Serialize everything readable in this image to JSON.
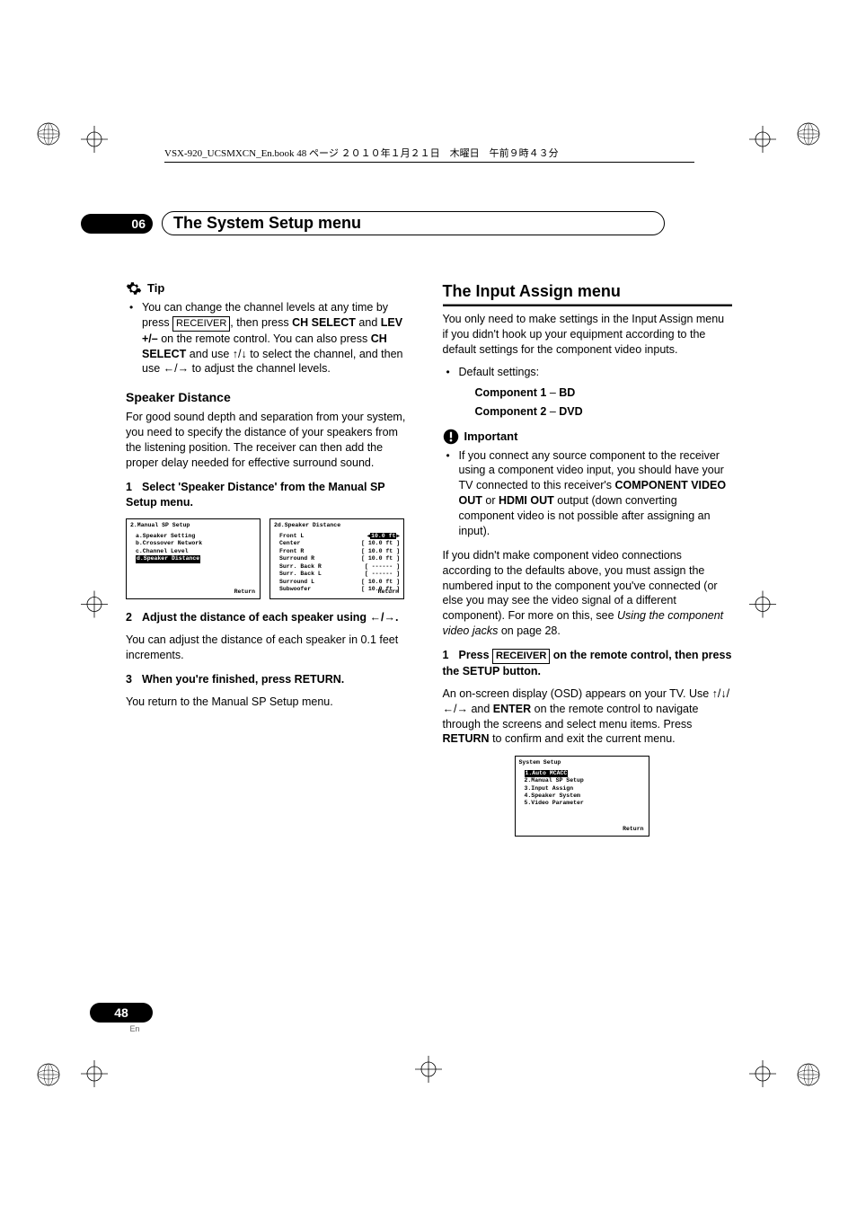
{
  "header_line": "VSX-920_UCSMXCN_En.book  48 ページ  ２０１０年１月２１日　木曜日　午前９時４３分",
  "chapter": {
    "num": "06",
    "title": "The System Setup menu"
  },
  "left": {
    "tip_label": "Tip",
    "tip_text_1": "You can change the channel levels at any time by press ",
    "tip_receiver": "RECEIVER",
    "tip_text_2": ", then press ",
    "tip_bold_1": "CH SELECT",
    "tip_text_3": " and ",
    "tip_bold_2": "LEV +/–",
    "tip_text_4": " on the remote control. You can also press ",
    "tip_bold_3": "CH SELECT",
    "tip_text_5": " and use ",
    "tip_text_6": " to select the channel, and then use ",
    "tip_text_7": " to adjust the channel levels.",
    "speaker_h": "Speaker Distance",
    "speaker_p": "For good sound depth and separation from your system, you need to specify the distance of your speakers from the listening position. The receiver can then add the proper delay needed for effective surround sound.",
    "step1": "Select 'Speaker Distance' from the Manual SP Setup menu.",
    "osd1": {
      "title": "2.Manual SP Setup",
      "items": [
        "a.Speaker Setting",
        "b.Crossover Network",
        "c.Channel Level",
        "d.Speaker Distance"
      ],
      "sel_index": 3,
      "return": "Return"
    },
    "osd2": {
      "title": "2d.Speaker Distance",
      "rows": [
        {
          "l": "Front L",
          "v": "10.0 ft",
          "sel": true
        },
        {
          "l": "Center",
          "v": "10.0 ft"
        },
        {
          "l": "Front R",
          "v": "10.0 ft"
        },
        {
          "l": "Surround R",
          "v": "10.0 ft"
        },
        {
          "l": "Surr. Back R",
          "v": "------"
        },
        {
          "l": "Surr. Back L",
          "v": "------"
        },
        {
          "l": "Surround L",
          "v": "10.0 ft"
        },
        {
          "l": "Subwoofer",
          "v": "10.0 ft"
        }
      ],
      "return": "Return"
    },
    "step2": "Adjust the distance of each speaker using ",
    "step2b": ".",
    "step2_p": "You can adjust the distance of each speaker in 0.1 feet increments.",
    "step3": "When you're finished, press RETURN.",
    "step3_p": "You return to the Manual SP Setup menu."
  },
  "right": {
    "h": "The Input Assign menu",
    "p1": "You only need to make settings in the Input Assign menu if you didn't hook up your equipment according to the default settings for the component video inputs.",
    "defaults_label": "Default settings:",
    "comp1a": "Component 1",
    "dash": " – ",
    "comp1b": "BD",
    "comp2a": "Component 2",
    "comp2b": "DVD",
    "important_label": "Important",
    "imp_text_1": "If you connect any source component to the receiver using a component video input, you should have your TV connected to this receiver's ",
    "imp_bold_1": "COMPONENT VIDEO OUT",
    "imp_text_2": " or ",
    "imp_bold_2": "HDMI OUT",
    "imp_text_3": " output (down converting component video is not possible after assigning an input).",
    "p2a": "If you didn't make component video connections according to the defaults above, you must assign the numbered input to the component you've connected (or else you may see the video signal of a different component). For more on this, see ",
    "p2i": "Using the component video jacks",
    "p2b": " on page 28.",
    "step1a": "Press ",
    "step1_receiver": "RECEIVER",
    "step1b": " on the remote control, then press the SETUP button.",
    "step1_p_a": "An on-screen display (OSD) appears on your TV. Use ",
    "step1_p_b": " and ",
    "step1_bold": "ENTER",
    "step1_p_c": " on the remote control to navigate through the screens and select menu items. Press ",
    "step1_bold2": "RETURN",
    "step1_p_d": " to confirm and exit the current menu.",
    "osd3": {
      "title": "System Setup",
      "items": [
        "1.Auto MCACC",
        "2.Manual SP Setup",
        "3.Input Assign",
        "4.Speaker System",
        "5.Video Parameter"
      ],
      "sel_index": 0,
      "return": "Return"
    }
  },
  "page_num": "48",
  "page_lang": "En"
}
